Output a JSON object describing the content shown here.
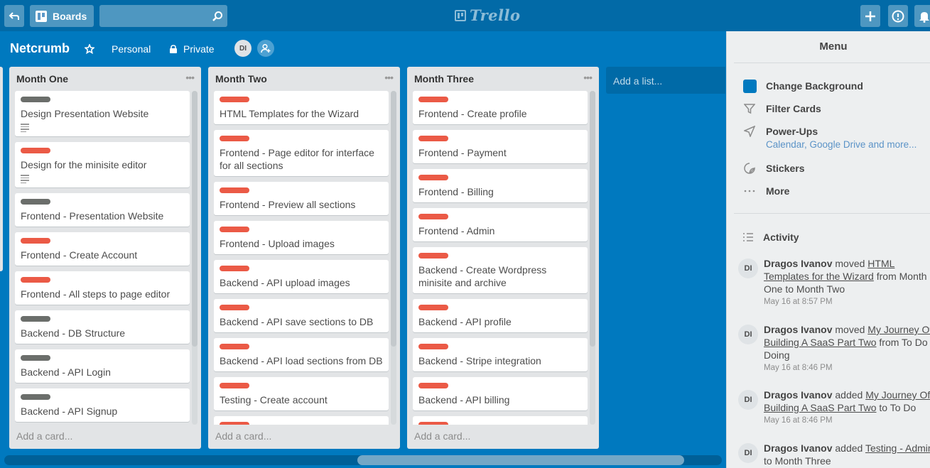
{
  "header": {
    "boards_label": "Boards",
    "logo_text": "Trello"
  },
  "board": {
    "title": "Netcrumb",
    "team": "Personal",
    "visibility": "Private",
    "member_initials": "DI"
  },
  "colors": {
    "board_bg": "#0079bf",
    "label_red": "#eb5a46",
    "label_gray": "#6b6e6b"
  },
  "lists": [
    {
      "name": "Month One",
      "add_card": "Add a card...",
      "cards": [
        {
          "title": "Design Presentation Website",
          "label": "gray",
          "has_description": true
        },
        {
          "title": "Design for the minisite editor",
          "label": "red",
          "has_description": true
        },
        {
          "title": "Frontend - Presentation Website",
          "label": "gray",
          "has_description": false
        },
        {
          "title": "Frontend - Create Account",
          "label": "red",
          "has_description": false
        },
        {
          "title": "Frontend - All steps to page editor",
          "label": "red",
          "has_description": false
        },
        {
          "title": "Backend - DB Structure",
          "label": "gray",
          "has_description": false
        },
        {
          "title": "Backend - API Login",
          "label": "gray",
          "has_description": false
        },
        {
          "title": "Backend - API Signup",
          "label": "gray",
          "has_description": false
        }
      ]
    },
    {
      "name": "Month Two",
      "add_card": "Add a card...",
      "cards": [
        {
          "title": "HTML Templates for the Wizard",
          "label": "red",
          "has_description": false
        },
        {
          "title": "Frontend - Page editor for interface for all sections",
          "label": "red",
          "has_description": false
        },
        {
          "title": "Frontend - Preview all sections",
          "label": "red",
          "has_description": false
        },
        {
          "title": "Frontend - Upload images",
          "label": "red",
          "has_description": false
        },
        {
          "title": "Backend - API upload images",
          "label": "red",
          "has_description": false
        },
        {
          "title": "Backend - API save sections to DB",
          "label": "red",
          "has_description": false
        },
        {
          "title": "Backend - API load sections from DB",
          "label": "red",
          "has_description": false
        },
        {
          "title": "Testing - Create account",
          "label": "red",
          "has_description": false
        },
        {
          "title": "",
          "label": "red",
          "has_description": false
        }
      ]
    },
    {
      "name": "Month Three",
      "add_card": "Add a card...",
      "cards": [
        {
          "title": "Frontend - Create profile",
          "label": "red",
          "has_description": false
        },
        {
          "title": "Frontend - Payment",
          "label": "red",
          "has_description": false
        },
        {
          "title": "Frontend - Billing",
          "label": "red",
          "has_description": false
        },
        {
          "title": "Frontend - Admin",
          "label": "red",
          "has_description": false
        },
        {
          "title": "Backend - Create Wordpress minisite and archive",
          "label": "red",
          "has_description": false
        },
        {
          "title": "Backend - API profile",
          "label": "red",
          "has_description": false
        },
        {
          "title": "Backend - Stripe integration",
          "label": "red",
          "has_description": false
        },
        {
          "title": "Backend - API billing",
          "label": "red",
          "has_description": false
        },
        {
          "title": "",
          "label": "red",
          "has_description": false
        }
      ]
    }
  ],
  "add_list": "Add a list...",
  "menu": {
    "title": "Menu",
    "items": [
      {
        "label": "Change Background",
        "icon": "background-swatch"
      },
      {
        "label": "Filter Cards",
        "icon": "filter-icon"
      },
      {
        "label": "Power-Ups",
        "icon": "power-ups-icon",
        "sub": "Calendar, Google Drive and more..."
      },
      {
        "label": "Stickers",
        "icon": "sticker-icon"
      },
      {
        "label": "More",
        "icon": "more-icon"
      }
    ],
    "activity_title": "Activity",
    "activity": [
      {
        "initials": "DI",
        "user": "Dragos Ivanov",
        "action": "moved",
        "link": "HTML Templates for the Wizard",
        "rest": "from Month One to Month Two",
        "time": "May 16 at 8:57 PM"
      },
      {
        "initials": "DI",
        "user": "Dragos Ivanov",
        "action": "moved",
        "link": "My Journey Of Building A SaaS Part Two",
        "rest": "from To Do Doing",
        "time": "May 16 at 8:46 PM"
      },
      {
        "initials": "DI",
        "user": "Dragos Ivanov",
        "action": "added",
        "link": "My Journey Of Building A SaaS Part Two",
        "rest": "to To Do",
        "time": "May 16 at 8:46 PM"
      },
      {
        "initials": "DI",
        "user": "Dragos Ivanov",
        "action": "added",
        "link": "Testing - Admin",
        "rest": "to Month Three",
        "time": ""
      }
    ]
  }
}
